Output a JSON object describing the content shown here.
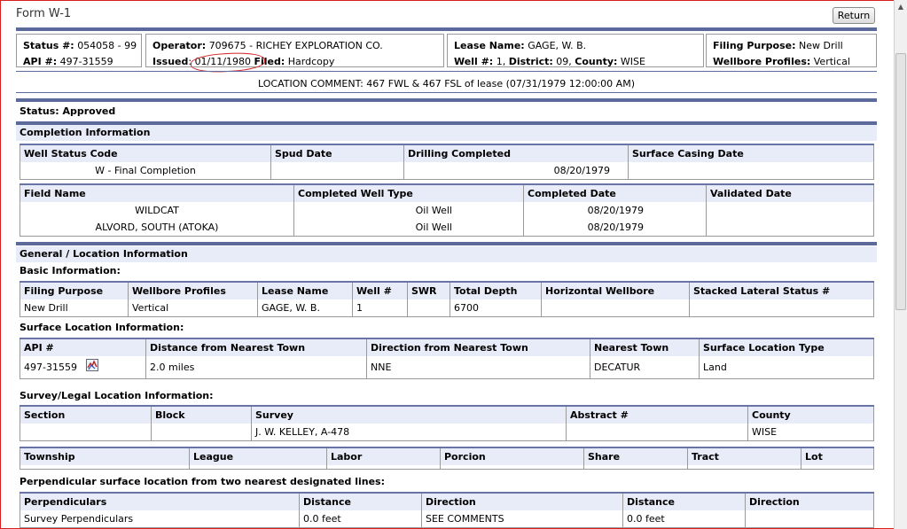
{
  "header": {
    "form_title": "Form W-1",
    "return_label": "Return"
  },
  "summary": {
    "status_no_label": "Status #:",
    "status_no": "054058 - 99",
    "api_label": "API #:",
    "api": "497-31559",
    "operator_label": "Operator:",
    "operator": "709675 - RICHEY EXPLORATION CO.",
    "issued_label": "Issued",
    "issued": "01/11/1980",
    "filed_label": "Filed:",
    "filed": "Hardcopy",
    "lease_label": "Lease Name:",
    "lease": "GAGE, W. B.",
    "well_label": "Well #:",
    "well": "1",
    "district_label": "District:",
    "district": "09",
    "county_label": "County:",
    "county": "WISE",
    "filing_purpose_label": "Filing Purpose:",
    "filing_purpose": "New Drill",
    "wellbore_label": "Wellbore Profiles:",
    "wellbore": "Vertical",
    "location_comment": "LOCATION COMMENT: 467 FWL & 467 FSL of lease (07/31/1979 12:00:00 AM)",
    "status_line": "Status: Approved"
  },
  "completion": {
    "title": "Completion Information",
    "t1_headers": [
      "Well Status Code",
      "Spud Date",
      "Drilling Completed",
      "Surface Casing Date"
    ],
    "t1_row": [
      "W - Final Completion",
      "",
      "08/20/1979",
      ""
    ],
    "t2_headers": [
      "Field Name",
      "Completed Well Type",
      "Completed Date",
      "Validated Date"
    ],
    "t2_rows": [
      [
        "WILDCAT",
        "Oil Well",
        "08/20/1979",
        ""
      ],
      [
        "ALVORD, SOUTH (ATOKA)",
        "Oil Well",
        "08/20/1979",
        ""
      ]
    ]
  },
  "general": {
    "title": "General / Location Information",
    "basic_title": "Basic Information:",
    "basic_headers": [
      "Filing Purpose",
      "Wellbore Profiles",
      "Lease Name",
      "Well #",
      "SWR",
      "Total Depth",
      "Horizontal Wellbore",
      "Stacked Lateral Status #"
    ],
    "basic_row": [
      "New Drill",
      "Vertical",
      "GAGE, W. B.",
      "1",
      "",
      "6700",
      "",
      ""
    ],
    "surface_title": "Surface Location Information:",
    "surface_headers": [
      "API #",
      "Distance from Nearest Town",
      "Direction from Nearest Town",
      "Nearest Town",
      "Surface Location Type"
    ],
    "surface_row": [
      "497-31559",
      "2.0 miles",
      "NNE",
      "DECATUR",
      "Land"
    ],
    "survey_title": "Survey/Legal Location Information:",
    "survey_headers": [
      "Section",
      "Block",
      "Survey",
      "Abstract #",
      "County"
    ],
    "survey_row": [
      "",
      "",
      "J. W. KELLEY, A-478",
      "",
      "WISE"
    ],
    "township_headers": [
      "Township",
      "League",
      "Labor",
      "Porcion",
      "Share",
      "Tract",
      "Lot"
    ],
    "perp_title": "Perpendicular surface location from two nearest designated lines:",
    "perp_headers": [
      "Perpendiculars",
      "Distance",
      "Direction",
      "Distance",
      "Direction"
    ],
    "perp_row": [
      "Survey Perpendiculars",
      "0.0 feet",
      "SEE COMMENTS",
      "0.0 feet",
      ""
    ]
  },
  "icons": {
    "map": "map-icon",
    "scroll_up": "scroll-up-arrow-icon"
  },
  "colors": {
    "accent": "#5b6a9a",
    "header_fill": "#e8ebf8",
    "annotation": "#d62020"
  }
}
